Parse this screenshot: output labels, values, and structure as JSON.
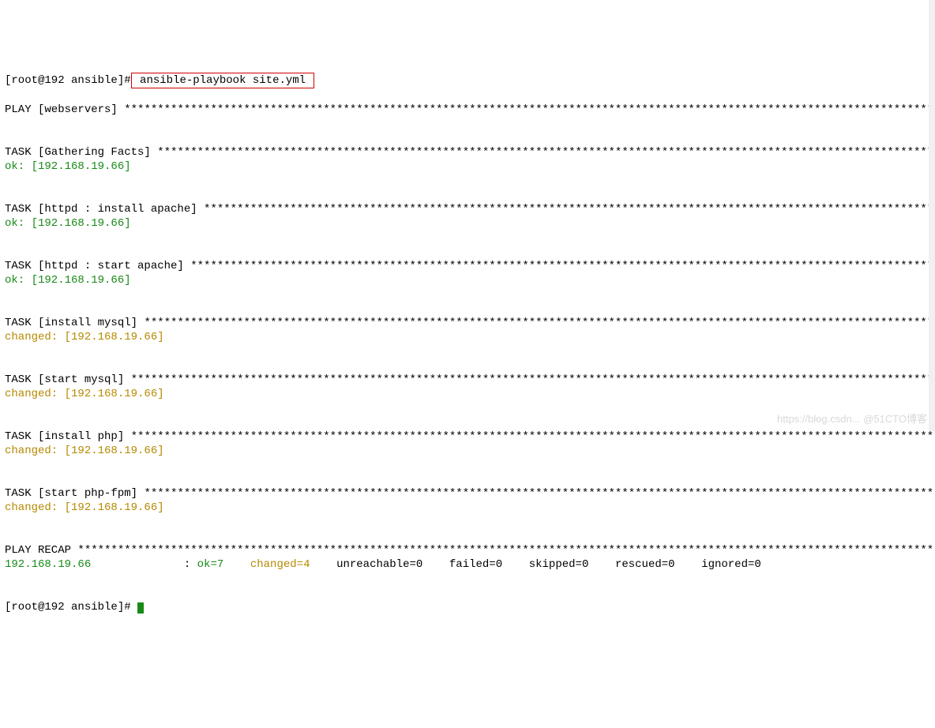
{
  "prompt1_prefix": "[root@192 ansible]#",
  "command_highlighted": " ansible-playbook site.yml ",
  "play_header_label": "PLAY [webservers] ",
  "task_gather_label": "TASK [Gathering Facts] ",
  "ok_host": "ok: [192.168.19.66]",
  "task_install_apache_label": "TASK [httpd : install apache] ",
  "task_start_apache_label": "TASK [httpd : start apache] ",
  "task_install_mysql_label": "TASK [install mysql] ",
  "changed_host": "changed: [192.168.19.66]",
  "task_start_mysql_label": "TASK [start mysql] ",
  "task_install_php_label": "TASK [install php] ",
  "task_start_phpfpm_label": "TASK [start php-fpm] ",
  "recap_label": "PLAY RECAP ",
  "recap_host": "192.168.19.66",
  "recap_sep": "              : ",
  "recap_ok": "ok=7",
  "recap_changed": "    changed=4",
  "recap_unreachable": "    unreachable=0",
  "recap_failed": "    failed=0",
  "recap_skipped": "    skipped=0",
  "recap_rescued": "    rescued=0",
  "recap_ignored": "    ignored=0",
  "prompt2": "[root@192 ansible]# ",
  "watermark": "https://blog.csdn... @51CTO博客"
}
